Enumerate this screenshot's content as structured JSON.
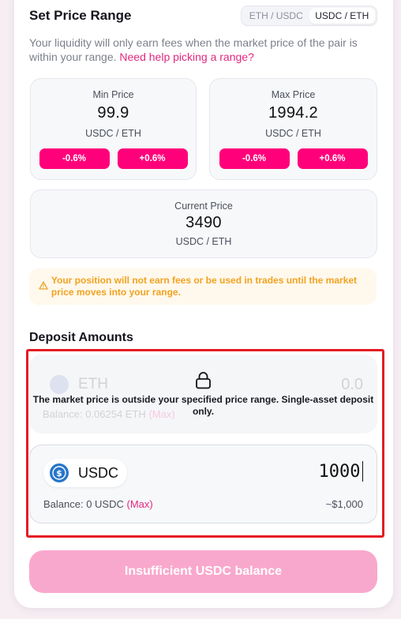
{
  "range": {
    "title": "Set Price Range",
    "toggle": [
      "ETH / USDC",
      "USDC / ETH"
    ],
    "active_toggle": 1,
    "description": "Your liquidity will only earn fees when the market price of the pair is within your range.",
    "help_link": "Need help picking a range?"
  },
  "min_price": {
    "label": "Min Price",
    "value": "99.9",
    "unit": "USDC / ETH",
    "decrement": "-0.6%",
    "increment": "+0.6%"
  },
  "max_price": {
    "label": "Max Price",
    "value": "1994.2",
    "unit": "USDC / ETH",
    "decrement": "-0.6%",
    "increment": "+0.6%"
  },
  "current_price": {
    "label": "Current Price",
    "value": "3490",
    "unit": "USDC / ETH"
  },
  "warning": {
    "icon": "warning-triangle-icon",
    "text": "Your position will not earn fees or be used in trades until the market price moves into your range."
  },
  "deposit": {
    "title": "Deposit Amounts",
    "locked": {
      "token": "ETH",
      "amount": "0.0",
      "balance": "Balance: 0.06254 ETH",
      "max": "(Max)",
      "icon": "lock-icon",
      "message": "The market price is outside your specified price range. Single-asset deposit only."
    },
    "active": {
      "token": "USDC",
      "amount": "1000",
      "balance": "Balance: 0 USDC",
      "max": "(Max)",
      "usd_value": "~$1,000"
    }
  },
  "cta": {
    "label": "Insufficient USDC balance"
  },
  "colors": {
    "accent": "#ff007a",
    "cta_disabled": "#f9a8cd",
    "warning": "#f0a321",
    "highlight": "#e51c23"
  }
}
